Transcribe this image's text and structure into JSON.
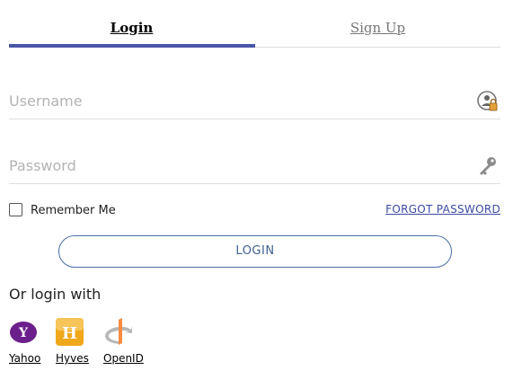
{
  "tabs": {
    "login_label": "Login",
    "signup_label": "Sign Up"
  },
  "form": {
    "username_placeholder": "Username",
    "username_value": "",
    "password_placeholder": "Password",
    "password_value": "",
    "remember_label": "Remember Me",
    "remember_checked": false,
    "forgot_label": "FORGOT PASSWORD",
    "login_button_label": "LOGIN"
  },
  "social": {
    "heading": "Or login with",
    "providers": [
      {
        "label": "Yahoo",
        "icon": "yahoo-icon"
      },
      {
        "label": "Hyves",
        "icon": "hyves-icon"
      },
      {
        "label": "OpenID",
        "icon": "openid-icon"
      }
    ]
  },
  "colors": {
    "accent": "#4a56a8",
    "button_border": "#4a6fa5",
    "link": "#3b4aa3",
    "yahoo": "#6b1f8a",
    "hyves": "#f0a81b",
    "openid": "#f78c40"
  }
}
